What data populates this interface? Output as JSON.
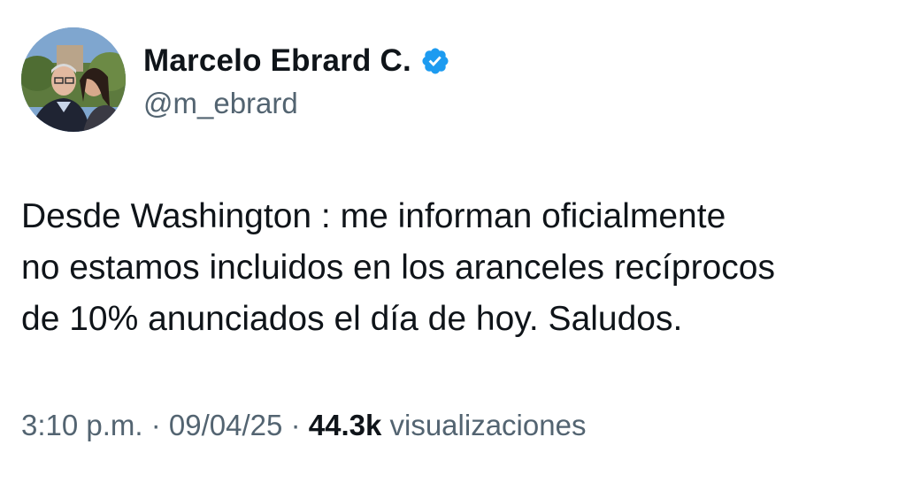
{
  "author": {
    "display_name": "Marcelo Ebrard C.",
    "handle": "@m_ebrard",
    "verified": true,
    "verified_color": "#1d9bf0"
  },
  "tweet": {
    "lines": [
      "Desde Washington : me informan oficialmente",
      "no estamos incluidos en los aranceles recíprocos",
      "de 10% anunciados el día de hoy. Saludos."
    ]
  },
  "meta": {
    "time": "3:10 p.m.",
    "separator": "·",
    "date": "09/04/25",
    "views_count": "44.3k",
    "views_label": "visualizaciones"
  },
  "colors": {
    "text_primary": "#0f1419",
    "text_secondary": "#536471",
    "background": "#ffffff"
  }
}
